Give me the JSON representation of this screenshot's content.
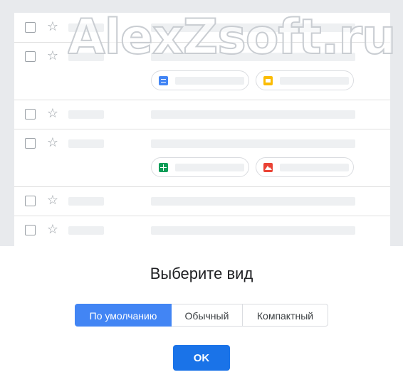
{
  "watermark": {
    "text": "AlexZsoft.ru"
  },
  "preview": {
    "attachment_icons": [
      "docs-icon",
      "slides-icon",
      "sheets-icon",
      "image-icon"
    ]
  },
  "dialog": {
    "title": "Выберите вид",
    "density_options": [
      "По умолчанию",
      "Обычный",
      "Компактный"
    ],
    "selected_option": "По умолчанию",
    "ok_label": "OK"
  },
  "colors": {
    "accent": "#4285f4",
    "ok_button": "#1a73e8",
    "background": "#e8eaed"
  }
}
